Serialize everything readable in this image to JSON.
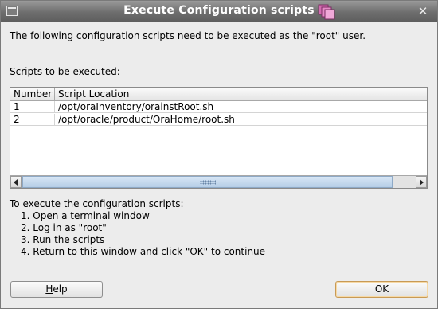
{
  "window": {
    "title": "Execute Configuration scripts",
    "title_bar_color": "#6e6e6e",
    "icons": [
      "window-menu-icon",
      "app-icon",
      "close-icon"
    ]
  },
  "intro_text": "The following configuration scripts need to be executed as the \"root\" user.",
  "scripts_label": {
    "mnemonic": "S",
    "rest": "cripts to be executed:"
  },
  "table": {
    "columns": [
      "Number",
      "Script Location"
    ],
    "rows": [
      {
        "number": "1",
        "location": "/opt/oraInventory/orainstRoot.sh"
      },
      {
        "number": "2",
        "location": "/opt/oracle/product/OraHome/root.sh"
      }
    ]
  },
  "instructions": {
    "heading": "To execute the configuration scripts:",
    "steps": [
      "1. Open a terminal window",
      "2. Log in as \"root\"",
      "3. Run the scripts",
      "4. Return to this window and click \"OK\" to continue"
    ]
  },
  "buttons": {
    "help": {
      "mnemonic": "H",
      "rest": "elp"
    },
    "ok": "OK"
  },
  "accent_color": "#c89a55"
}
